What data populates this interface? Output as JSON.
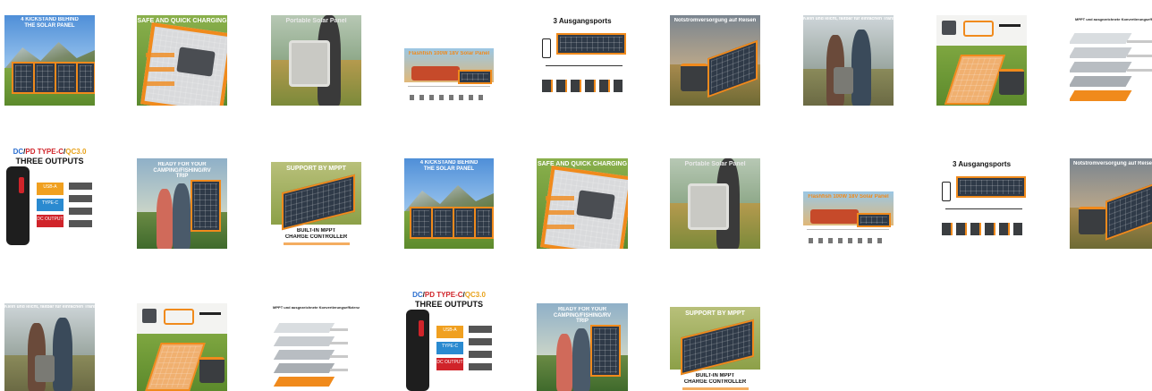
{
  "thumbnails": [
    {
      "caption": "4 KICKSTAND BEHIND THE SOLAR PANEL"
    },
    {
      "caption": "SAFE AND QUICK CHARGING"
    },
    {
      "caption": "Portable Solar Panel"
    },
    {
      "caption": "Flashfish 100W 18V Solar Panel"
    },
    {
      "caption": "3 Ausgangsports"
    },
    {
      "caption": "Notstromversorgung auf Reisen"
    },
    {
      "caption": "Klein und leicht, faltbar für einfachen Transport"
    },
    {
      "caption": ""
    },
    {
      "caption": "MPPT und ausgezeichnete Konvertierungseffizienz"
    },
    {
      "caption": "DC/PD TYPE-C/QC3.0",
      "caption2": "THREE OUTPUTS",
      "labels": [
        "USB-A",
        "TYPE-C",
        "DC OUTPUT"
      ]
    },
    {
      "caption": "READY FOR YOUR CAMPING/FISHING/RV TRIP"
    },
    {
      "caption": "SUPPORT BY MPPT",
      "caption2": "BUILT-IN MPPT",
      "caption3": "CHARGE CONTROLLER"
    },
    {
      "caption": "4 KICKSTAND BEHIND THE SOLAR PANEL"
    },
    {
      "caption": "SAFE AND QUICK CHARGING"
    },
    {
      "caption": "Portable Solar Panel"
    },
    {
      "caption": "Flashfish 100W 18V Solar Panel"
    },
    {
      "caption": "3 Ausgangsports"
    },
    {
      "caption": "Notstromversorgung auf Reisen"
    },
    {
      "caption": "Klein und leicht, faltbar für einfachen Transport"
    },
    {
      "caption": ""
    },
    {
      "caption": "MPPT und ausgezeichnete Konvertierungseffizienz"
    },
    {
      "caption": "DC/PD TYPE-C/QC3.0",
      "caption2": "THREE OUTPUTS",
      "labels": [
        "USB-A",
        "TYPE-C",
        "DC OUTPUT"
      ]
    },
    {
      "caption": "READY FOR YOUR CAMPING/FISHING/RV TRIP"
    },
    {
      "caption": "SUPPORT BY MPPT",
      "caption2": "BUILT-IN MPPT",
      "caption3": "CHARGE CONTROLLER"
    }
  ],
  "colors": {
    "accent": "#f08a1c",
    "dc": "#2a6ecf",
    "pd": "#d0242a",
    "qc": "#e8a21a"
  }
}
